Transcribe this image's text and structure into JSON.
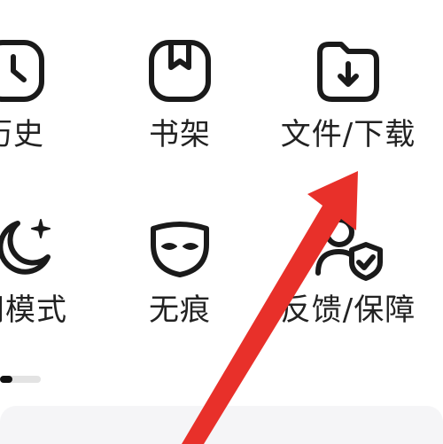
{
  "menu": {
    "items": [
      {
        "label": "历史",
        "icon": "clock-icon"
      },
      {
        "label": "书架",
        "icon": "bookshelf-icon"
      },
      {
        "label": "文件/下载",
        "icon": "download-folder-icon"
      },
      {
        "label": "夜间模式",
        "icon": "moon-star-icon"
      },
      {
        "label": "无痕",
        "icon": "mask-icon"
      },
      {
        "label": "反馈/保障",
        "icon": "user-shield-icon"
      }
    ]
  },
  "pager": {
    "current_page": 1,
    "total_pages": 3
  },
  "annotation": {
    "arrow_color": "#e8302a",
    "points_to": "文件/下载"
  },
  "colors": {
    "text": "#222222",
    "icon_stroke": "#1a1a1a",
    "panel_bg": "#f5f5f7"
  }
}
